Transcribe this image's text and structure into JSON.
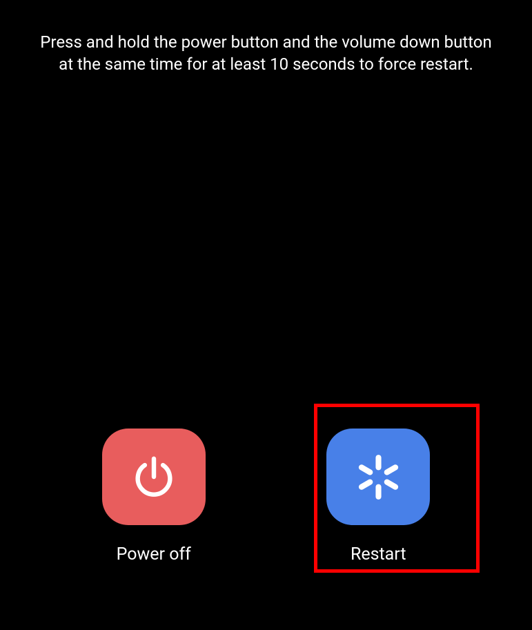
{
  "instruction": "Press and hold the power button and the volume down button at the same time for at least 10 seconds to force restart.",
  "buttons": {
    "power_off": {
      "label": "Power off",
      "icon": "power-icon",
      "color": "#e85d5d"
    },
    "restart": {
      "label": "Restart",
      "icon": "restart-icon",
      "color": "#4880e8"
    }
  },
  "highlighted": "restart"
}
